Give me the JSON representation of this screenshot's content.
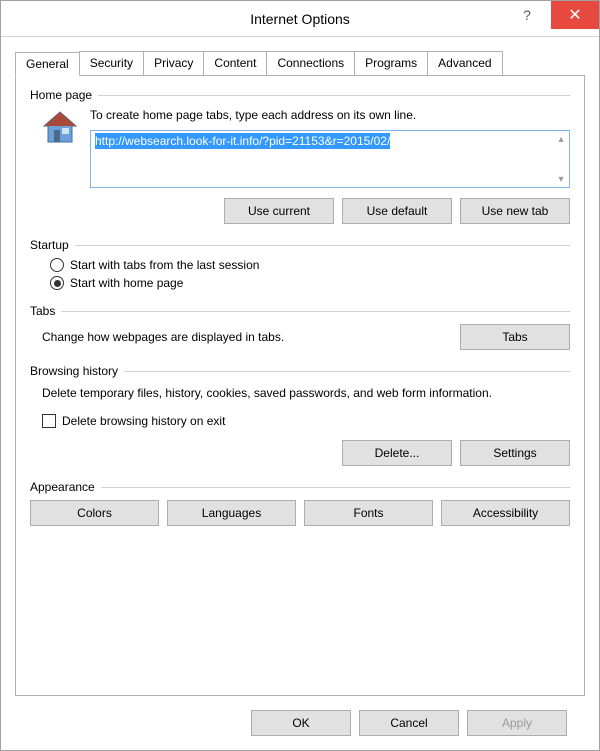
{
  "window": {
    "title": "Internet Options"
  },
  "tabs": {
    "items": [
      "General",
      "Security",
      "Privacy",
      "Content",
      "Connections",
      "Programs",
      "Advanced"
    ],
    "active": 0
  },
  "homepage": {
    "title": "Home page",
    "desc": "To create home page tabs, type each address on its own line.",
    "url": "http://websearch.look-for-it.info/?pid=21153&r=2015/02/",
    "buttons": {
      "use_current": "Use current",
      "use_default": "Use default",
      "use_new_tab": "Use new tab"
    }
  },
  "startup": {
    "title": "Startup",
    "opt_last_session": "Start with tabs from the last session",
    "opt_home_page": "Start with home page",
    "selected": "home"
  },
  "tabs_section": {
    "title": "Tabs",
    "desc": "Change how webpages are displayed in tabs.",
    "button": "Tabs"
  },
  "history": {
    "title": "Browsing history",
    "desc": "Delete temporary files, history, cookies, saved passwords, and web form information.",
    "checkbox_label": "Delete browsing history on exit",
    "delete_btn": "Delete...",
    "settings_btn": "Settings"
  },
  "appearance": {
    "title": "Appearance",
    "colors": "Colors",
    "languages": "Languages",
    "fonts": "Fonts",
    "accessibility": "Accessibility"
  },
  "footer": {
    "ok": "OK",
    "cancel": "Cancel",
    "apply": "Apply"
  }
}
